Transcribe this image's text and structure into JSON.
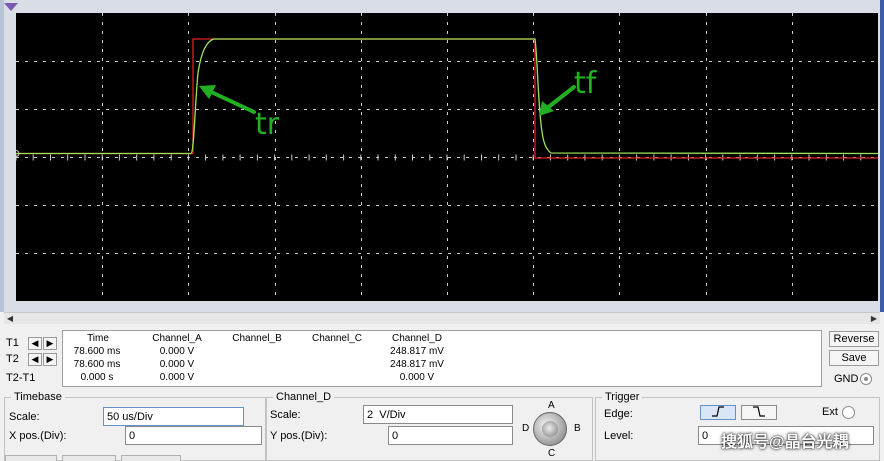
{
  "scope": {
    "background": "#000000",
    "grid_color": "#cfcfcf",
    "trace_a_color": "#e02020",
    "trace_b_color": "#9ee35a",
    "annotation_color": "#22b022",
    "annotations": {
      "rise": "tr",
      "fall": "tf"
    }
  },
  "measurement": {
    "row_labels": [
      "T1",
      "T2",
      "T2-T1"
    ],
    "headers": [
      "Time",
      "Channel_A",
      "Channel_B",
      "Channel_C",
      "Channel_D"
    ],
    "rows": [
      [
        "78.600 ms",
        "0.000 V",
        "",
        "",
        "248.817 mV"
      ],
      [
        "78.600 ms",
        "0.000 V",
        "",
        "",
        "248.817 mV"
      ],
      [
        "0.000 s",
        "0.000 V",
        "",
        "",
        "0.000 V"
      ]
    ]
  },
  "buttons": {
    "reverse": "Reverse",
    "save": "Save",
    "gnd": "GND"
  },
  "timebase": {
    "title": "Timebase",
    "scale_label": "Scale:",
    "scale_value": "50 us/Div",
    "xpos_label": "X pos.(Div):",
    "xpos_value": "0"
  },
  "channel_d": {
    "title": "Channel_D",
    "scale_label": "Scale:",
    "scale_value": "2  V/Div",
    "ypos_label": "Y pos.(Div):",
    "ypos_value": "0",
    "dial_letters": {
      "a": "A",
      "b": "B",
      "c": "C",
      "d": "D"
    }
  },
  "trigger": {
    "title": "Trigger",
    "edge_label": "Edge:",
    "level_label": "Level:",
    "level_value": "0",
    "ext_label": "Ext"
  },
  "watermark": "搜狐号@晶台光耦"
}
